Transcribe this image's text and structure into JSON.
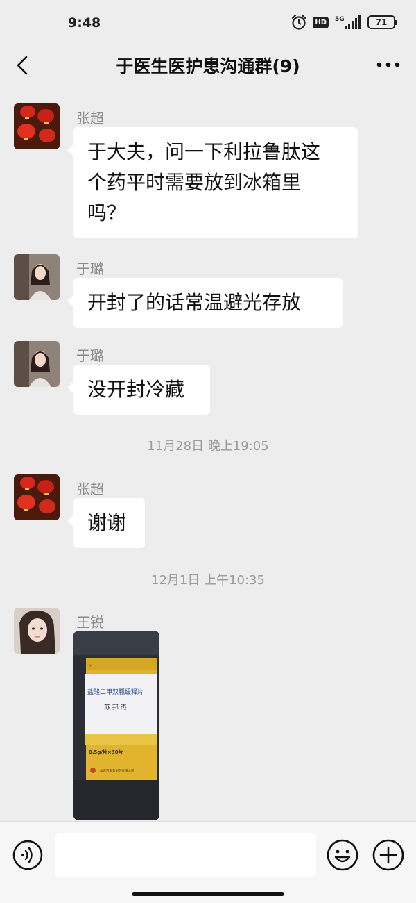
{
  "status_bar": {
    "time": "9:48",
    "alarm_icon": "alarm-clock-icon",
    "hd_badge": "HD",
    "network": "5G",
    "battery": "71"
  },
  "nav": {
    "back_icon": "chevron-left-icon",
    "title": "于医生医护患沟通群(9)",
    "more_icon": "more-horizontal-icon"
  },
  "messages": [
    {
      "sender": "张超",
      "avatar": "red-lanterns-avatar",
      "text_lines": [
        "于大夫，问一下利拉鲁肽这",
        "个药平时需要放到冰箱里",
        "吗？"
      ]
    },
    {
      "sender": "于璐",
      "avatar": "woman-photo-avatar",
      "text": "开封了的话常温避光存放"
    },
    {
      "sender": "于璐",
      "avatar": "woman-photo-avatar",
      "text": "没开封冷藏"
    },
    {
      "sender": "张超",
      "avatar": "red-lanterns-avatar",
      "text": "谢谢"
    },
    {
      "sender": "王锐",
      "avatar": "woman-portrait-avatar",
      "image": "medicine-box-photo"
    }
  ],
  "image_message": {
    "box_title": "盐酸二甲双胍缓释片",
    "box_handwriting": "苏 邦 杰",
    "box_dosage": "0.5g/片×30片",
    "box_brand": "山东百姿鲁制药有限公司"
  },
  "timestamps": [
    "11月28日 晚上19:05",
    "12月1日 上午10:35"
  ],
  "input_bar": {
    "voice_icon": "voice-icon",
    "input_value": "",
    "emoji_icon": "emoji-icon",
    "plus_icon": "plus-icon"
  },
  "colors": {
    "background": "#ededed",
    "bubble": "#ffffff",
    "sender_name": "#8a8a8a",
    "timestamp": "#9b9b9b"
  }
}
